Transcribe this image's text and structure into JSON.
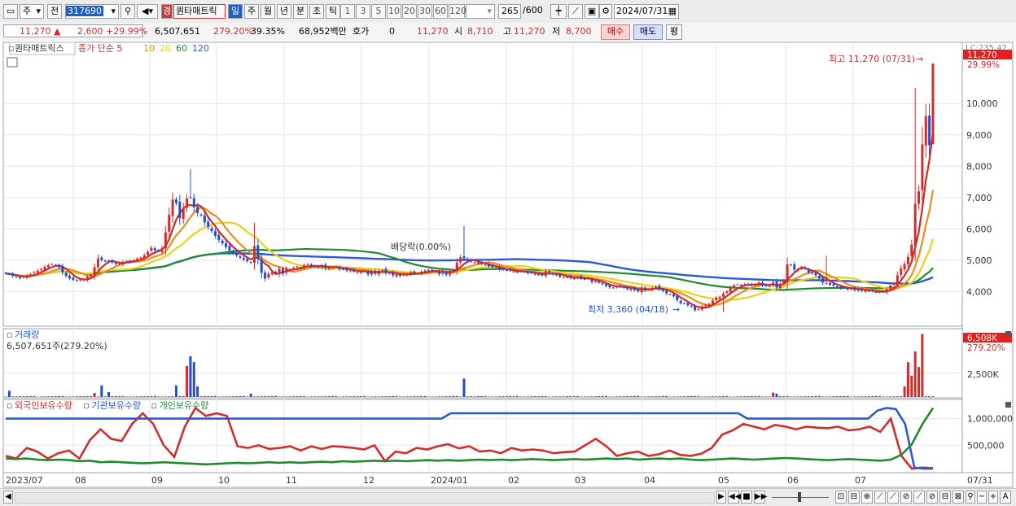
{
  "toolbar": {
    "market": "주",
    "type": "전",
    "code": "317690",
    "name": "퀀타매트릭",
    "name_badge": "경",
    "periods": [
      "일",
      "주",
      "월",
      "년",
      "분",
      "초",
      "틱"
    ],
    "active_period": "일",
    "minutes": [
      "1",
      "3",
      "5",
      "10",
      "20",
      "30",
      "60",
      "120"
    ],
    "count": "265",
    "count_total": "/600",
    "date": "2024/07/31"
  },
  "pricebar": {
    "price": "11,270",
    "change": "2,600",
    "change_pct": "+29.99%",
    "volume": "6,507,651",
    "volume_ratio": "279.20%",
    "turnover": "39.35%",
    "amount": "68,952백만",
    "quote_label": "호가",
    "quote_value": "0",
    "quote_price": "11,270",
    "open_label": "시",
    "open": "8,710",
    "high_label": "고",
    "high": "11,270",
    "low_label": "저",
    "low": "8,700",
    "buy_label": "매수",
    "sell_label": "매도",
    "eval_label": "평"
  },
  "colors": {
    "up": "#d42b2b",
    "down": "#1f4fd0",
    "ma5": "#d42b2b",
    "ma10": "#f08c1c",
    "ma20": "#e8d21a",
    "ma60": "#1f8c2c",
    "ma120": "#2a58d8"
  },
  "chart_data": [
    {
      "type": "candlestick",
      "title": "퀀타매트릭스",
      "legend": [
        "종가 단순 5",
        "10",
        "20",
        "60",
        "120"
      ],
      "legend_items": [
        {
          "label": "종가 단순 5",
          "color": "#d42b2b"
        },
        {
          "label": "10",
          "color": "#f08c1c"
        },
        {
          "label": "20",
          "color": "#e8d21a"
        },
        {
          "label": "60",
          "color": "#1f8c2c"
        },
        {
          "label": "120",
          "color": "#2a58d8"
        }
      ],
      "ylim": [
        2950,
        11900
      ],
      "yticks": [
        "4,000",
        "5,000",
        "6,000",
        "7,000",
        "8,000",
        "9,000",
        "10,000"
      ],
      "ytick_values": [
        4000,
        5000,
        6000,
        7000,
        8000,
        9000,
        10000
      ],
      "x_labels": [
        "2023/07",
        "08",
        "09",
        "10",
        "11",
        "12",
        "2024/01",
        "02",
        "03",
        "04",
        "05",
        "06",
        "07",
        "07/31"
      ],
      "last_price_label": "11,270",
      "last_change_label": "29.99%",
      "corner_label": "LC:235.42",
      "annotations": {
        "high": "최고 11,270 (07/31)",
        "low": "최저 3,360 (04/18)",
        "dividend": "배당락(0.00%)"
      },
      "key_points": [
        {
          "date": "2023-09-05",
          "high": 7900
        },
        {
          "date": "2023-10-17",
          "high": 6200
        },
        {
          "date": "2024-01-02",
          "high": 6100
        },
        {
          "date": "2024-04-18",
          "low": 3360
        },
        {
          "date": "2024-06-03",
          "high": 5150
        },
        {
          "date": "2024-07-26",
          "high": 10500
        },
        {
          "date": "2024-07-31",
          "open": 8710,
          "high": 11270,
          "low": 8700,
          "close": 11270
        }
      ],
      "closes": [
        4580,
        4560,
        4500,
        4470,
        4430,
        4470,
        4520,
        4560,
        4620,
        4670,
        4720,
        4790,
        4850,
        4880,
        4850,
        4780,
        4620,
        4500,
        4420,
        4380,
        4350,
        4400,
        4380,
        4470,
        4530,
        4780,
        5060,
        5010,
        4980,
        4950,
        4930,
        4870,
        4900,
        4950,
        4970,
        4990,
        5000,
        5050,
        5090,
        5160,
        5270,
        5400,
        5310,
        5310,
        5390,
        5890,
        6450,
        6940,
        6830,
        6350,
        6670,
        6970,
        7000,
        6690,
        6500,
        6440,
        6210,
        6060,
        5930,
        5780,
        5650,
        5540,
        5420,
        5310,
        5230,
        5160,
        5080,
        5020,
        4970,
        4920,
        5450,
        5050,
        4600,
        4420,
        4570,
        4620,
        4590,
        4730,
        4580,
        4740,
        4720,
        4760,
        4800,
        4750,
        4840,
        4880,
        4810,
        4820,
        4770,
        4840,
        4750,
        4760,
        4770,
        4800,
        4710,
        4710,
        4670,
        4680,
        4640,
        4610,
        4650,
        4680,
        4550,
        4640,
        4570,
        4660,
        4690,
        4590,
        4600,
        4520,
        4560,
        4500,
        4560,
        4560,
        4620,
        4580,
        4570,
        4640,
        4650,
        4690,
        4690,
        4660,
        4560,
        4670,
        4540,
        4660,
        4680,
        4930,
        5090,
        5060,
        4980,
        4960,
        4930,
        4900,
        4880,
        4860,
        4810,
        4780,
        4770,
        4700,
        4700,
        4680,
        4670,
        4640,
        4620,
        4650,
        4650,
        4590,
        4590,
        4550,
        4540,
        4520,
        4650,
        4620,
        4550,
        4530,
        4480,
        4460,
        4460,
        4430,
        4430,
        4460,
        4420,
        4400,
        4430,
        4310,
        4320,
        4290,
        4240,
        4180,
        4140,
        4130,
        4170,
        4180,
        4130,
        4080,
        4120,
        4050,
        4010,
        4120,
        4040,
        4080,
        4120,
        4160,
        4080,
        4020,
        3940,
        3920,
        3850,
        3730,
        3630,
        3620,
        3560,
        3520,
        3410,
        3440,
        3530,
        3580,
        3610,
        3720,
        3810,
        3840,
        3940,
        4010,
        4120,
        4200,
        4230,
        4190,
        4240,
        4250,
        4200,
        4240,
        4290,
        4200,
        4180,
        4190,
        4290,
        4130,
        4250,
        4350,
        4870,
        4850,
        4700,
        4720,
        4750,
        4730,
        4610,
        4580,
        4520,
        4420,
        4290,
        4280,
        4220,
        4190,
        4160,
        4110,
        4120,
        4070,
        4090,
        4050,
        4090,
        4030,
        4040,
        4020,
        4010,
        3980,
        3990,
        3990,
        4080,
        4190,
        4270,
        4520,
        4740,
        4880,
        5110,
        5500,
        6800,
        7200,
        8700,
        9600,
        8670,
        11270
      ]
    },
    {
      "type": "bar",
      "title": "거래량",
      "summary": "6,507,651주(279.20%)",
      "last_label": "6,508K",
      "last_sub": "279.20%",
      "ylim": [
        0,
        6800
      ],
      "ytick_label": "2,500K",
      "ytick_value": 2500,
      "unit": "K",
      "spikes": [
        {
          "index": 1,
          "value": 650
        },
        {
          "index": 25,
          "value": 430
        },
        {
          "index": 27,
          "value": 1200
        },
        {
          "index": 29,
          "value": 500
        },
        {
          "index": 48,
          "value": 1200
        },
        {
          "index": 51,
          "value": 3200
        },
        {
          "index": 52,
          "value": 4200
        },
        {
          "index": 53,
          "value": 3600
        },
        {
          "index": 54,
          "value": 1100
        },
        {
          "index": 69,
          "value": 350
        },
        {
          "index": 129,
          "value": 1900
        },
        {
          "index": 216,
          "value": 450
        },
        {
          "index": 217,
          "value": 350
        },
        {
          "index": 253,
          "value": 1100
        },
        {
          "index": 254,
          "value": 3600
        },
        {
          "index": 255,
          "value": 2200
        },
        {
          "index": 256,
          "value": 4700
        },
        {
          "index": 257,
          "value": 3100
        },
        {
          "index": 258,
          "value": 6508
        }
      ]
    },
    {
      "type": "line",
      "title": "외국인보유수량",
      "legend": [
        "외국인보유수량",
        "기관보유수량",
        "개인보유수량"
      ],
      "legend_items": [
        {
          "label": "외국인보유수량",
          "color": "#d42b2b"
        },
        {
          "label": "기관보유수량",
          "color": "#2a58d8"
        },
        {
          "label": "개인보유수량",
          "color": "#1f8c2c"
        }
      ],
      "ylim": [
        0,
        1330000
      ],
      "yticks": [
        "500,000",
        "1,000,000"
      ],
      "ytick_values": [
        500000,
        1000000
      ],
      "series": [
        {
          "name": "외국인보유수량",
          "values": [
            300000,
            250000,
            450000,
            380000,
            250000,
            350000,
            400000,
            250000,
            600000,
            800000,
            620000,
            580000,
            900000,
            1100000,
            900000,
            500000,
            280000,
            850000,
            1200000,
            1050000,
            1100000,
            1050000,
            480000,
            450000,
            500000,
            430000,
            450000,
            480000,
            400000,
            480000,
            430000,
            480000,
            470000,
            450000,
            420000,
            500000,
            200000,
            380000,
            350000,
            450000,
            420000,
            480000,
            520000,
            440000,
            480000,
            380000,
            400000,
            350000,
            450000,
            400000,
            420000,
            400000,
            350000,
            370000,
            380000,
            500000,
            620000,
            480000,
            300000,
            350000,
            380000,
            300000,
            330000,
            400000,
            320000,
            300000,
            340000,
            450000,
            700000,
            780000,
            900000,
            850000,
            800000,
            880000,
            850000,
            800000,
            850000,
            830000,
            820000,
            850000,
            780000,
            800000,
            850000,
            750000,
            1000000,
            300000,
            60000,
            80000,
            70000
          ]
        },
        {
          "name": "기관보유수량",
          "values": [
            1000000,
            1000000,
            1000000,
            1000000,
            1000000,
            1000000,
            1000000,
            1000000,
            1000000,
            1000000,
            1000000,
            1000000,
            1000000,
            1000000,
            1000000,
            1000000,
            1000000,
            1000000,
            1000000,
            1000000,
            1000000,
            1000000,
            1000000,
            1000000,
            1000000,
            1000000,
            1000000,
            1000000,
            1000000,
            1000000,
            1000000,
            1000000,
            1000000,
            1000000,
            1000000,
            1000000,
            1000000,
            1000000,
            1000000,
            1000000,
            1000000,
            1000000,
            1000000,
            1000000,
            1000000,
            1000000,
            1000000,
            1000000,
            1100000,
            1100000,
            1100000,
            1100000,
            1100000,
            1100000,
            1100000,
            1100000,
            1100000,
            1100000,
            1100000,
            1100000,
            1100000,
            1100000,
            1100000,
            1100000,
            1100000,
            1100000,
            1100000,
            1100000,
            1100000,
            1100000,
            1100000,
            1100000,
            1100000,
            1100000,
            1100000,
            1100000,
            1100000,
            1100000,
            1100000,
            1100000,
            1000000,
            1000000,
            1000000,
            1000000,
            1000000,
            1000000,
            1000000,
            1000000,
            1000000,
            1000000,
            1000000,
            1000000,
            1000000,
            1000000,
            1150000,
            1200000,
            1180000,
            900000,
            80000,
            60000,
            60000
          ]
        },
        {
          "name": "개인보유수량",
          "values": [
            250000,
            240000,
            250000,
            230000,
            220000,
            230000,
            220000,
            200000,
            210000,
            180000,
            190000,
            180000,
            170000,
            160000,
            170000,
            180000,
            170000,
            160000,
            150000,
            140000,
            150000,
            160000,
            170000,
            160000,
            170000,
            180000,
            170000,
            180000,
            170000,
            180000,
            190000,
            180000,
            200000,
            190000,
            200000,
            210000,
            200000,
            210000,
            200000,
            210000,
            220000,
            210000,
            220000,
            210000,
            220000,
            230000,
            220000,
            230000,
            220000,
            230000,
            240000,
            230000,
            220000,
            230000,
            240000,
            230000,
            240000,
            250000,
            240000,
            250000,
            230000,
            240000,
            250000,
            240000,
            250000,
            230000,
            220000,
            230000,
            240000,
            250000,
            240000,
            230000,
            240000,
            250000,
            260000,
            250000,
            240000,
            230000,
            220000,
            230000,
            240000,
            230000,
            220000,
            210000,
            230000,
            320000,
            520000,
            900000,
            1200000
          ]
        }
      ]
    }
  ],
  "bottom": {
    "scroll_label": "◀"
  }
}
